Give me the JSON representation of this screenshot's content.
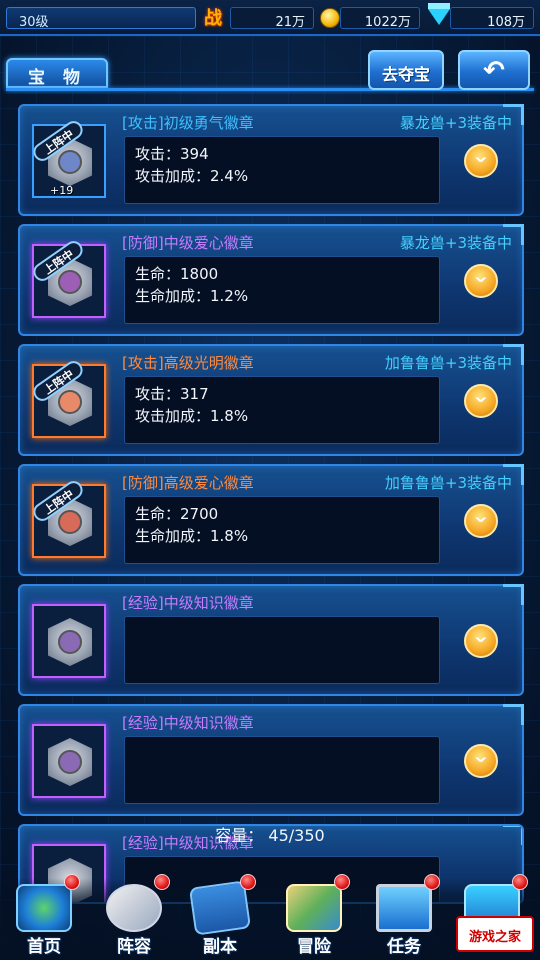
{
  "status": {
    "level": "30级",
    "combat_label": "战",
    "combat": "21万",
    "gold": "1022万",
    "diamond": "108万"
  },
  "header": {
    "tab_label": "宝 物",
    "loot_button": "去夺宝",
    "back_icon": "back-arrow-icon"
  },
  "items": [
    {
      "title": "[攻击]初级勇气徽章",
      "title_color": "#3ec0ff",
      "owner": "暴龙兽+3装备中",
      "tag": "上阵中",
      "plus": "+19",
      "line1": "攻击：394",
      "line2": "攻击加成：2.4%"
    },
    {
      "title": "[防御]中级爱心徽章",
      "title_color": "#c77bff",
      "owner": "暴龙兽+3装备中",
      "tag": "上阵中",
      "line1": "生命：1800",
      "line2": "生命加成：1.2%"
    },
    {
      "title": "[攻击]高级光明徽章",
      "title_color": "#ff8a3d",
      "owner": "加鲁鲁兽+3装备中",
      "tag": "上阵中",
      "line1": "攻击：317",
      "line2": "攻击加成：1.8%"
    },
    {
      "title": "[防御]高级爱心徽章",
      "title_color": "#ff8a3d",
      "owner": "加鲁鲁兽+3装备中",
      "tag": "上阵中",
      "line1": "生命：2700",
      "line2": "生命加成：1.8%"
    },
    {
      "title": "[经验]中级知识徽章",
      "title_color": "#c77bff"
    },
    {
      "title": "[经验]中级知识徽章",
      "title_color": "#c77bff"
    },
    {
      "title": "[经验]中级知识徽章",
      "title_color": "#c77bff"
    }
  ],
  "capacity": "容量：  45/350",
  "nav": [
    {
      "label": "首页",
      "icon": "home-icon"
    },
    {
      "label": "阵容",
      "icon": "team-icon"
    },
    {
      "label": "副本",
      "icon": "map-scroll-icon"
    },
    {
      "label": "冒险",
      "icon": "adventure-map-icon"
    },
    {
      "label": "任务",
      "icon": "task-monitor-icon"
    },
    {
      "label": "",
      "icon": "shop-icon"
    }
  ],
  "watermark": "游戏之家",
  "colors": {
    "accent": "#2a8ef0",
    "owner_text": "#43d0ff",
    "notification": "#e01818"
  }
}
